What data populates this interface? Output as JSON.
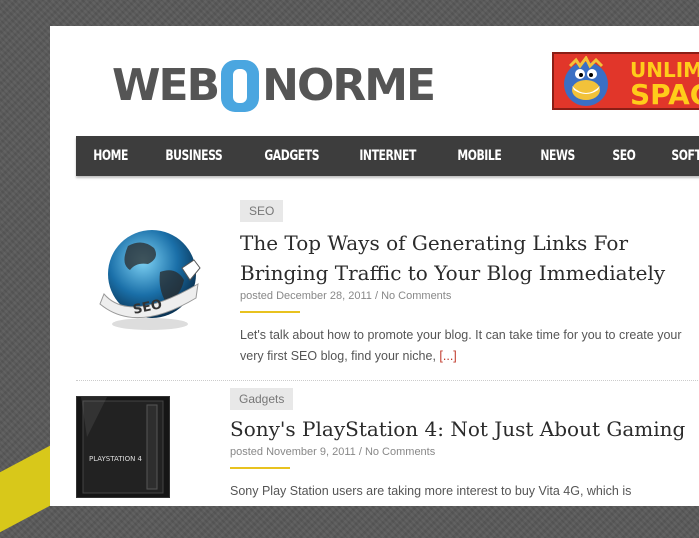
{
  "site": {
    "logo_left": "WEB",
    "logo_right": "NORME"
  },
  "ad": {
    "line1": "UNLIMI",
    "line2": "SPAC"
  },
  "nav": {
    "items": [
      "HOME",
      "BUSINESS",
      "GADGETS",
      "INTERNET",
      "MOBILE",
      "NEWS",
      "SEO",
      "SOFTWAR"
    ]
  },
  "posts": [
    {
      "tag": "SEO",
      "title": "The Top Ways of Generating Links For Bringing Traffic to Your Blog Immediately",
      "posted": "posted December 28, 2011",
      "sep": " / ",
      "comments": "No Comments",
      "excerpt": "Let's talk about how to promote your blog. It can take time for you to create your very first SEO blog, find your niche,",
      "more": "[...]",
      "thumb_label": "SEO"
    },
    {
      "tag": "Gadgets",
      "title": "Sony's PlayStation 4: Not Just About Gaming",
      "posted": "posted November 9, 2011",
      "sep": " / ",
      "comments": "No Comments",
      "excerpt": "Sony Play Station users are taking more interest to buy Vita 4G, which is",
      "thumb_label": "PLAYSTATION 4"
    }
  ]
}
